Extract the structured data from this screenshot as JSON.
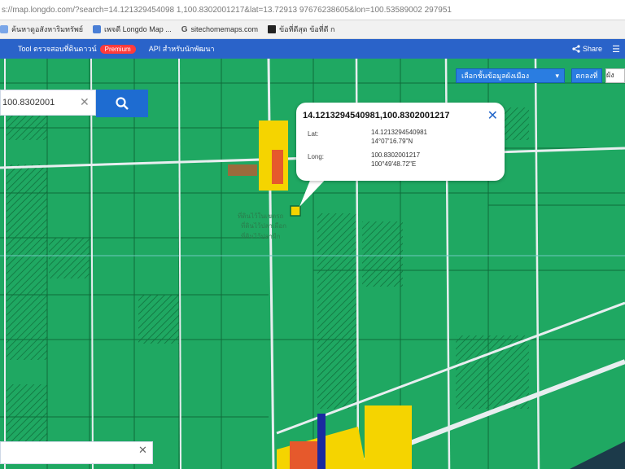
{
  "browser": {
    "url": "s://map.longdo.com/?search=14.121329454098 1,100.8302001217&lat=13.72913 97676238605&lon=100.53589002 297951"
  },
  "bookmarks": [
    {
      "label": "ค้นหาดูอสังหาริมทรัพย์",
      "icon": "bookmark-icon"
    },
    {
      "label": "เพจดี Longdo Map ...",
      "icon": "bookmark-icon"
    },
    {
      "label": "sitechomemaps.com",
      "icon": "google-icon"
    },
    {
      "label": "ข้อที่ดีสุด ข้อที่ดี ก",
      "icon": "bookmark-icon"
    }
  ],
  "toolbar": {
    "tool_label": "Tool ตรวจสอบที่ดินดาวน์",
    "badge": "Premium",
    "api_label": "API สำหรับนักพัฒนา",
    "share_label": "Share"
  },
  "search": {
    "value": "100.8302001",
    "clear_icon": "close-icon",
    "button_icon": "search-icon"
  },
  "layers": {
    "selected": "เลือกชั้นข้อมูลผังเมือง",
    "button_label": "ตกลงที่",
    "input_value": "ผัง"
  },
  "popup": {
    "title": "14.1213294540981,100.8302001217",
    "lat_label": "Lat:",
    "lat_decimal": "14.1213294540981",
    "lat_dms": "14°07'16.79\"N",
    "long_label": "Long:",
    "long_decimal": "100.8302001217",
    "long_dms": "100°49'48.72\"E"
  },
  "map_labels": {
    "label1": "ที่ดินไว้ในเขตรถ",
    "label2": "ที่ดินไว้ปลาเผือก",
    "label3": "ที่ดินไว้ปลาผีก"
  },
  "colors": {
    "map_green": "#1fa862",
    "parcel_line": "#0f6b3a",
    "road_white": "#e8eef0",
    "yellow_zone": "#f5d400",
    "toolbar_blue": "#2a63c9",
    "search_blue": "#1e6cd1",
    "popup_close": "#2366c9"
  }
}
